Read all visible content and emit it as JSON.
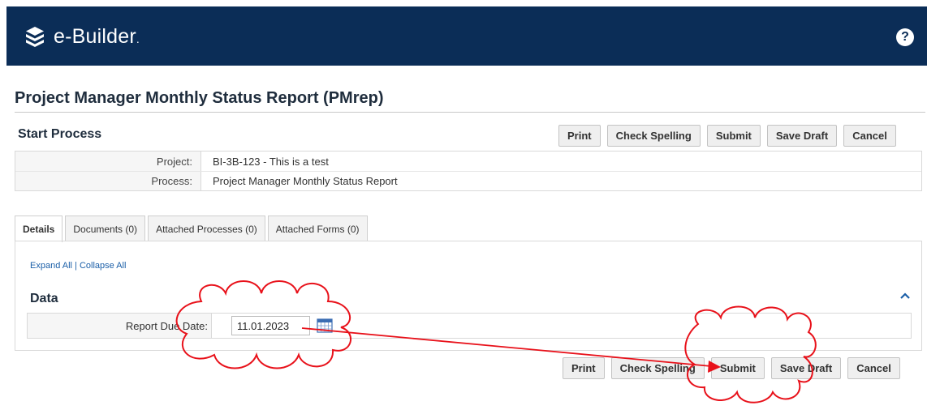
{
  "header": {
    "logo_text": "e-Builder",
    "logo_dot": ".",
    "help_icon": "?"
  },
  "page": {
    "title": "Project Manager Monthly Status Report (PMrep)",
    "subtitle": "Start Process"
  },
  "toolbar": {
    "print": "Print",
    "check_spelling": "Check Spelling",
    "submit": "Submit",
    "save_draft": "Save Draft",
    "cancel": "Cancel"
  },
  "info": {
    "project_label": "Project:",
    "project_value": "BI-3B-123 - This is a test",
    "process_label": "Process:",
    "process_value": "Project Manager Monthly Status Report"
  },
  "tabs": [
    {
      "label": "Details",
      "active": true
    },
    {
      "label": "Documents (0)"
    },
    {
      "label": "Attached Processes (0)"
    },
    {
      "label": "Attached Forms (0)"
    }
  ],
  "details": {
    "expand_all": "Expand All",
    "separator": " | ",
    "collapse_all": "Collapse All",
    "section_title": "Data",
    "report_due_label": "Report Due Date:",
    "report_due_value": "11.01.2023"
  },
  "colors": {
    "header_bg": "#0b2d57",
    "annotation_red": "#e8111a",
    "link_blue": "#1b5fa8"
  }
}
